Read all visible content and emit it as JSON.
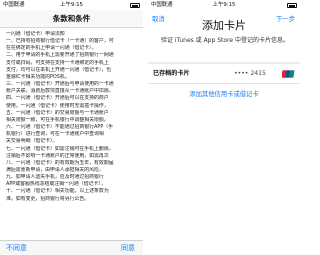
{
  "left": {
    "status": {
      "carrier": "中国联通",
      "time": "上午9:15"
    },
    "title": "条款和条件",
    "terms_lines": [
      "一闪通（借记卡）申请须知",
      "一、已持有招商银行借记卡（一卡通）的客户，可",
      "在在绑定的手机上申请一闪通（借记卡）。",
      "二、用于申请的手机上需要开通了招商银行一网通",
      "支付或扫码，可支持在支持一卡通绑定的手机上",
      "支付，均可以在本机上开通一闪通（借记卡），也",
      "金融IC卡相关功能的POS机。",
      "三、一闪通（借记卡）开通后与申请使用的一卡通",
      "账户关联，消费后款项直接从一卡通账户中扣除，",
      "四、一闪通（借记卡）开通后可以在支持的商户",
      "使用，一闪通（借记卡）使用时无需插卡操作，",
      "五、一闪通（借记卡）的交易限额与一卡通账户",
      "相关限额一致，可在手机银行中调整相关限额。",
      "六、一闪通（借记卡）不能通过招商银行APP（手",
      "机银行）进行查询，可在一卡通账户中查询相",
      "关交易明细（借记卡）。",
      "七、一闪通（借记卡）如需注销可在手机上删除，",
      "注销后不影响一卡通账户的正常使用，如需再次",
      "八、一闪通（借记卡）的有效期为五年，有效期届",
      "满后需重新申请，由申请人承担相关的风险，",
      "九、如申请人遗失手机，应及时通过招商银行",
      "APP或客服热线冻结或注销一闪通（借记卡），",
      "十、一闪通（借记卡）相关功能，以上述条款为",
      "准。如有变更，招商银行将另行公告。"
    ],
    "toolbar": {
      "disagree": "不同意",
      "agree": "同意"
    }
  },
  "right": {
    "status": {
      "carrier": "中国联通",
      "time": "上午9:15"
    },
    "nav": {
      "cancel": "取消",
      "next": "下一步"
    },
    "title": "添加卡片",
    "subtitle": "验证 iTunes 或 App Store 中登记的卡片信息。",
    "card": {
      "label": "已存档的卡片",
      "number": "•••• 2415",
      "brand_icon": "unionpay-icon"
    },
    "add_other_card": "添加其他信用卡或借记卡"
  },
  "colors": {
    "accent": "#1a7cf5",
    "text": "#111111",
    "divider": "#e2e2e2"
  }
}
